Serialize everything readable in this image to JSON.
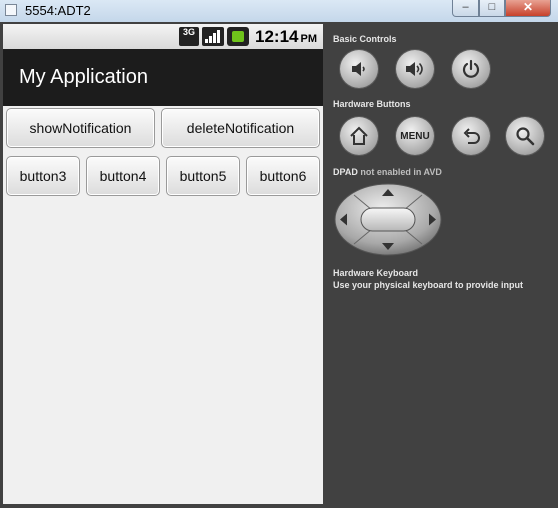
{
  "window": {
    "title": "5554:ADT2",
    "close_glyph": "✕",
    "min_glyph": "–",
    "max_glyph": "□"
  },
  "status_bar": {
    "network": "3G",
    "time": "12:14",
    "ampm": "PM",
    "battery_color": "#6fc41b"
  },
  "app": {
    "title": "My Application",
    "buttons_row1": [
      "showNotification",
      "deleteNotification"
    ],
    "buttons_row2": [
      "button3",
      "button4",
      "button5",
      "button6"
    ]
  },
  "panel": {
    "basic_controls_label": "Basic Controls",
    "hardware_buttons_label": "Hardware Buttons",
    "menu_label": "MENU",
    "dpad_label": "DPAD",
    "dpad_note": "not enabled in AVD",
    "keyboard_label": "Hardware Keyboard",
    "keyboard_note": "Use your physical keyboard to provide input"
  },
  "icons": [
    "volume-down-icon",
    "volume-up-icon",
    "power-icon",
    "home-icon",
    "back-icon",
    "search-icon"
  ]
}
